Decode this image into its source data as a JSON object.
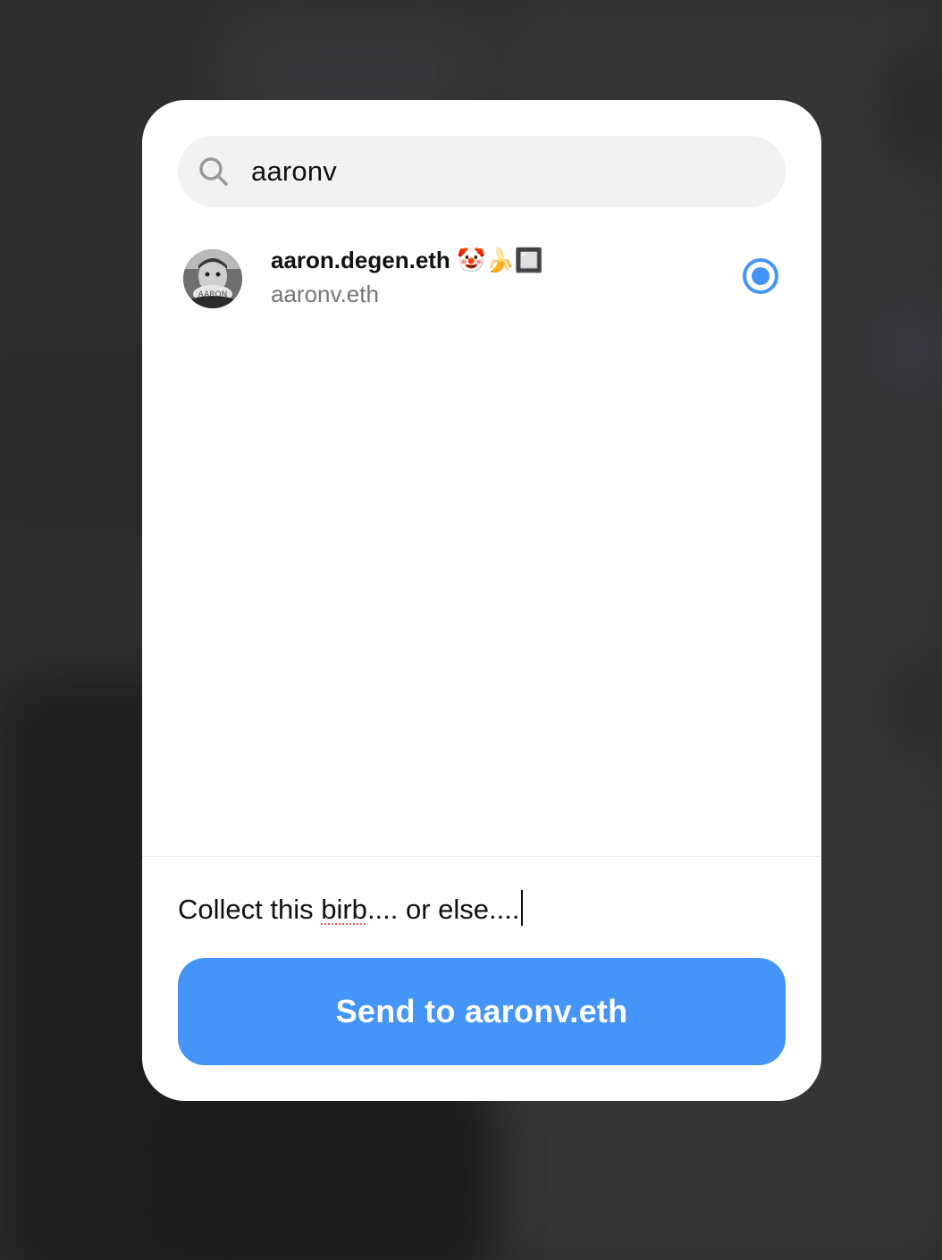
{
  "search": {
    "value": "aaronv",
    "icon": "search-icon"
  },
  "results": [
    {
      "display_name": "aaron.degen.eth 🤡🍌🔲",
      "handle": "aaronv.eth",
      "avatar_text": "AARON",
      "selected": true
    }
  ],
  "message": {
    "text_before": "Collect this ",
    "misspelled_word": "birb",
    "text_after": ".... or else...."
  },
  "send_button": {
    "label": "Send to aaronv.eth"
  },
  "colors": {
    "accent": "#4495f7",
    "backdrop": "#2e2e2f",
    "search_bg": "#f2f2f2",
    "secondary_text": "#777777"
  }
}
